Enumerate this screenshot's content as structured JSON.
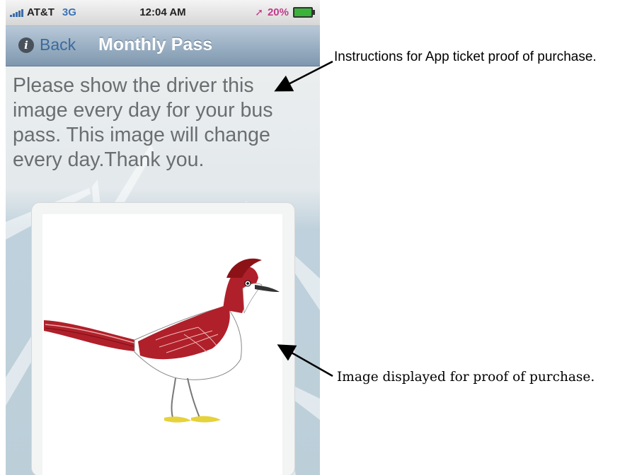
{
  "status_bar": {
    "carrier": "AT&T",
    "network": "3G",
    "time": "12:04 AM",
    "battery": "20%",
    "icons": [
      "signal-bars-icon",
      "location-arrow-icon",
      "battery-charging-icon"
    ]
  },
  "nav_bar": {
    "back_label": "Back",
    "title": "Monthly Pass",
    "back_icon": "info-icon"
  },
  "content": {
    "instructions": "Please show the driver this image every day for your bus pass. This image will change every day.Thank you.",
    "image_subject": "roadrunner bird illustration"
  },
  "annotations": {
    "top": "Instructions for App ticket proof of purchase.",
    "bottom": "Image displayed for proof of purchase."
  },
  "colors": {
    "nav_gradient_top": "#b8c9d9",
    "nav_gradient_bottom": "#7e97ae",
    "back_text": "#3d6a9c",
    "network_text": "#3b73b8",
    "battery_text": "#c23a8b",
    "instruction_text": "#6b6e70",
    "bird_red": "#b0202a"
  }
}
